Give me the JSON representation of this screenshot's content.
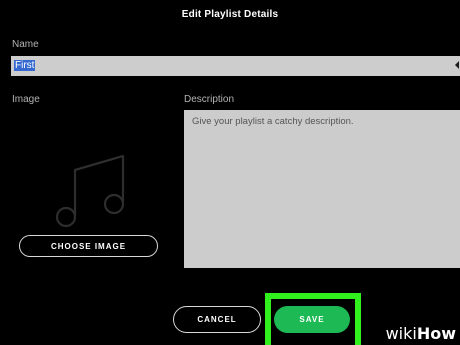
{
  "dialog": {
    "title": "Edit Playlist Details"
  },
  "name_field": {
    "label": "Name",
    "value": "First"
  },
  "image": {
    "label": "Image",
    "placeholder_icon": "music-note-icon",
    "choose_button_label": "CHOOSE IMAGE"
  },
  "description": {
    "label": "Description",
    "placeholder": "Give your playlist a catchy description."
  },
  "actions": {
    "cancel_label": "CANCEL",
    "save_label": "SAVE"
  },
  "watermark": {
    "wiki": "wiki",
    "how": "How"
  },
  "colors": {
    "background": "#000000",
    "accent_green": "#1db954",
    "highlight_green": "#30f01e",
    "input_bg": "#cccccc",
    "selection_blue": "#3569d0"
  }
}
